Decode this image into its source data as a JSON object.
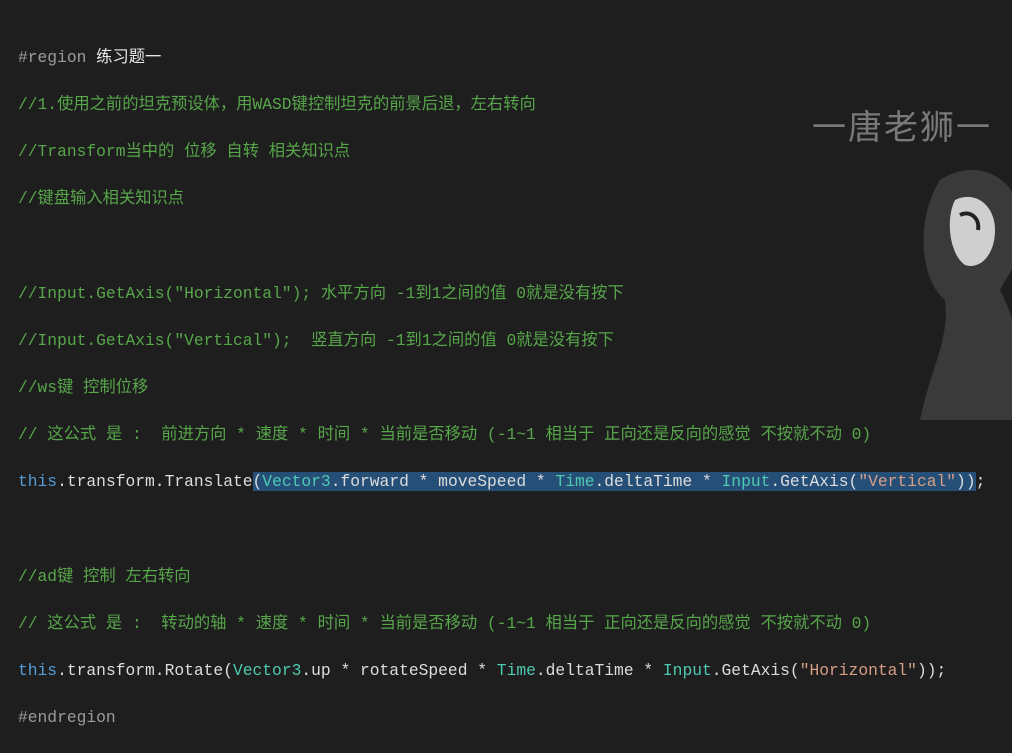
{
  "watermark": "一唐老狮一",
  "lines": {
    "l1a": "#region ",
    "l1b": "练习题一",
    "l2": "//1.使用之前的坦克预设体，用WASD键控制坦克的前景后退，左右转向",
    "l3": "//Transform当中的 位移 自转 相关知识点",
    "l4": "//键盘输入相关知识点",
    "l6": "//Input.GetAxis(\"Horizontal\"); 水平方向 -1到1之间的值 0就是没有按下",
    "l7": "//Input.GetAxis(\"Vertical\");  竖直方向 -1到1之间的值 0就是没有按下",
    "l8": "//ws键 控制位移",
    "l9": "// 这公式 是 :  前进方向 * 速度 * 时间 * 当前是否移动 (-1~1 相当于 正向还是反向的感觉 不按就不动 0)",
    "l10": {
      "this": "this",
      "a": ".transform.Translate",
      "p": "(",
      "v3": "Vector3",
      ".f": ".forward * moveSpeed * ",
      "time": "Time",
      ".dt": ".deltaTime * ",
      "input": "Input",
      ".ga": ".GetAxis(",
      "str": "\"Vertical\"",
      "end": "))",
      ";": ";"
    },
    "l12": "//ad键 控制 左右转向",
    "l13": "// 这公式 是 :  转动的轴 * 速度 * 时间 * 当前是否移动 (-1~1 相当于 正向还是反向的感觉 不按就不动 0)",
    "l14": {
      "this": "this",
      "a": ".transform.Rotate(",
      "v3": "Vector3",
      ".u": ".up * rotateSpeed * ",
      "time": "Time",
      ".dt": ".deltaTime * ",
      "input": "Input",
      ".ga": ".GetAxis(",
      "str": "\"Horizontal\"",
      "end": "));"
    },
    "l15": "#endregion"
  }
}
